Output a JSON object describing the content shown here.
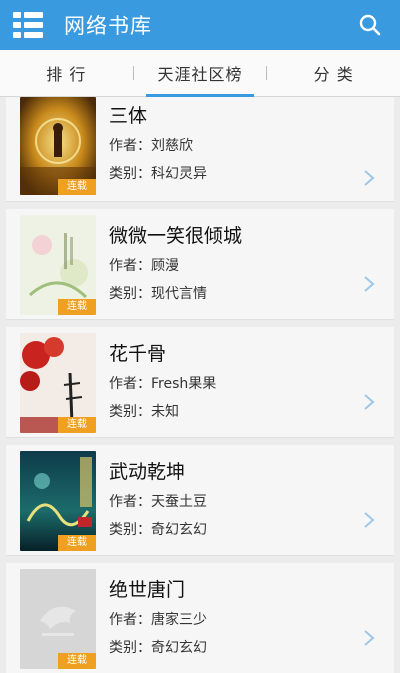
{
  "header": {
    "title": "网络书库",
    "menu_icon": "list-menu-icon",
    "search_icon": "search-icon"
  },
  "tabs": [
    {
      "label": "排 行",
      "active": false
    },
    {
      "label": "天涯社区榜",
      "active": true
    },
    {
      "label": "分 类",
      "active": false
    }
  ],
  "colors": {
    "accent": "#3a9ae0",
    "badge": "#f0a020",
    "chevron": "#9fc7e6"
  },
  "books": [
    {
      "title": "三体",
      "author": "作者：刘慈欣",
      "category": "类别：科幻灵异",
      "badge": "连载"
    },
    {
      "title": "微微一笑很倾城",
      "author": "作者：顾漫",
      "category": "类别：现代言情",
      "badge": "连载"
    },
    {
      "title": "花千骨",
      "author": "作者：Fresh果果",
      "category": "类别：未知",
      "badge": "连载"
    },
    {
      "title": "武动乾坤",
      "author": "作者：天蚕土豆",
      "category": "类别：奇幻玄幻",
      "badge": "连载"
    },
    {
      "title": "绝世唐门",
      "author": "作者：唐家三少",
      "category": "类别：奇幻玄幻",
      "badge": "连载"
    }
  ]
}
